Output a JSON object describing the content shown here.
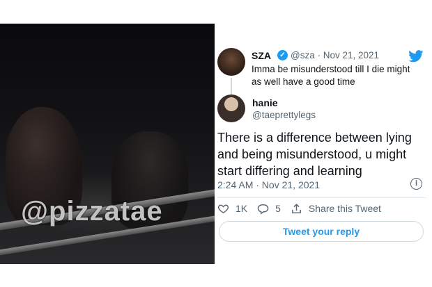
{
  "video": {
    "watermark": "@pizzatae"
  },
  "quoted_tweet": {
    "name": "SZA",
    "verified": true,
    "handle_date": "@sza · Nov 21, 2021",
    "text": "Imma be misunderstood till I die might as well have a good time"
  },
  "reply_tweet": {
    "name": "hanie",
    "handle": "@taeprettylegs",
    "text": "There is a difference between lying and being misunderstood, u might start differing and learning",
    "timestamp": "2:24 AM · Nov 21, 2021"
  },
  "actions": {
    "likes": "1K",
    "replies": "5",
    "share_label": "Share this Tweet"
  },
  "reply_button_label": "Tweet your reply",
  "colors": {
    "accent": "#1d9bf0",
    "secondary_text": "#536471"
  },
  "icons": [
    "twitter-bird-icon",
    "verified-badge-icon",
    "info-icon",
    "heart-icon",
    "reply-icon",
    "share-icon"
  ]
}
